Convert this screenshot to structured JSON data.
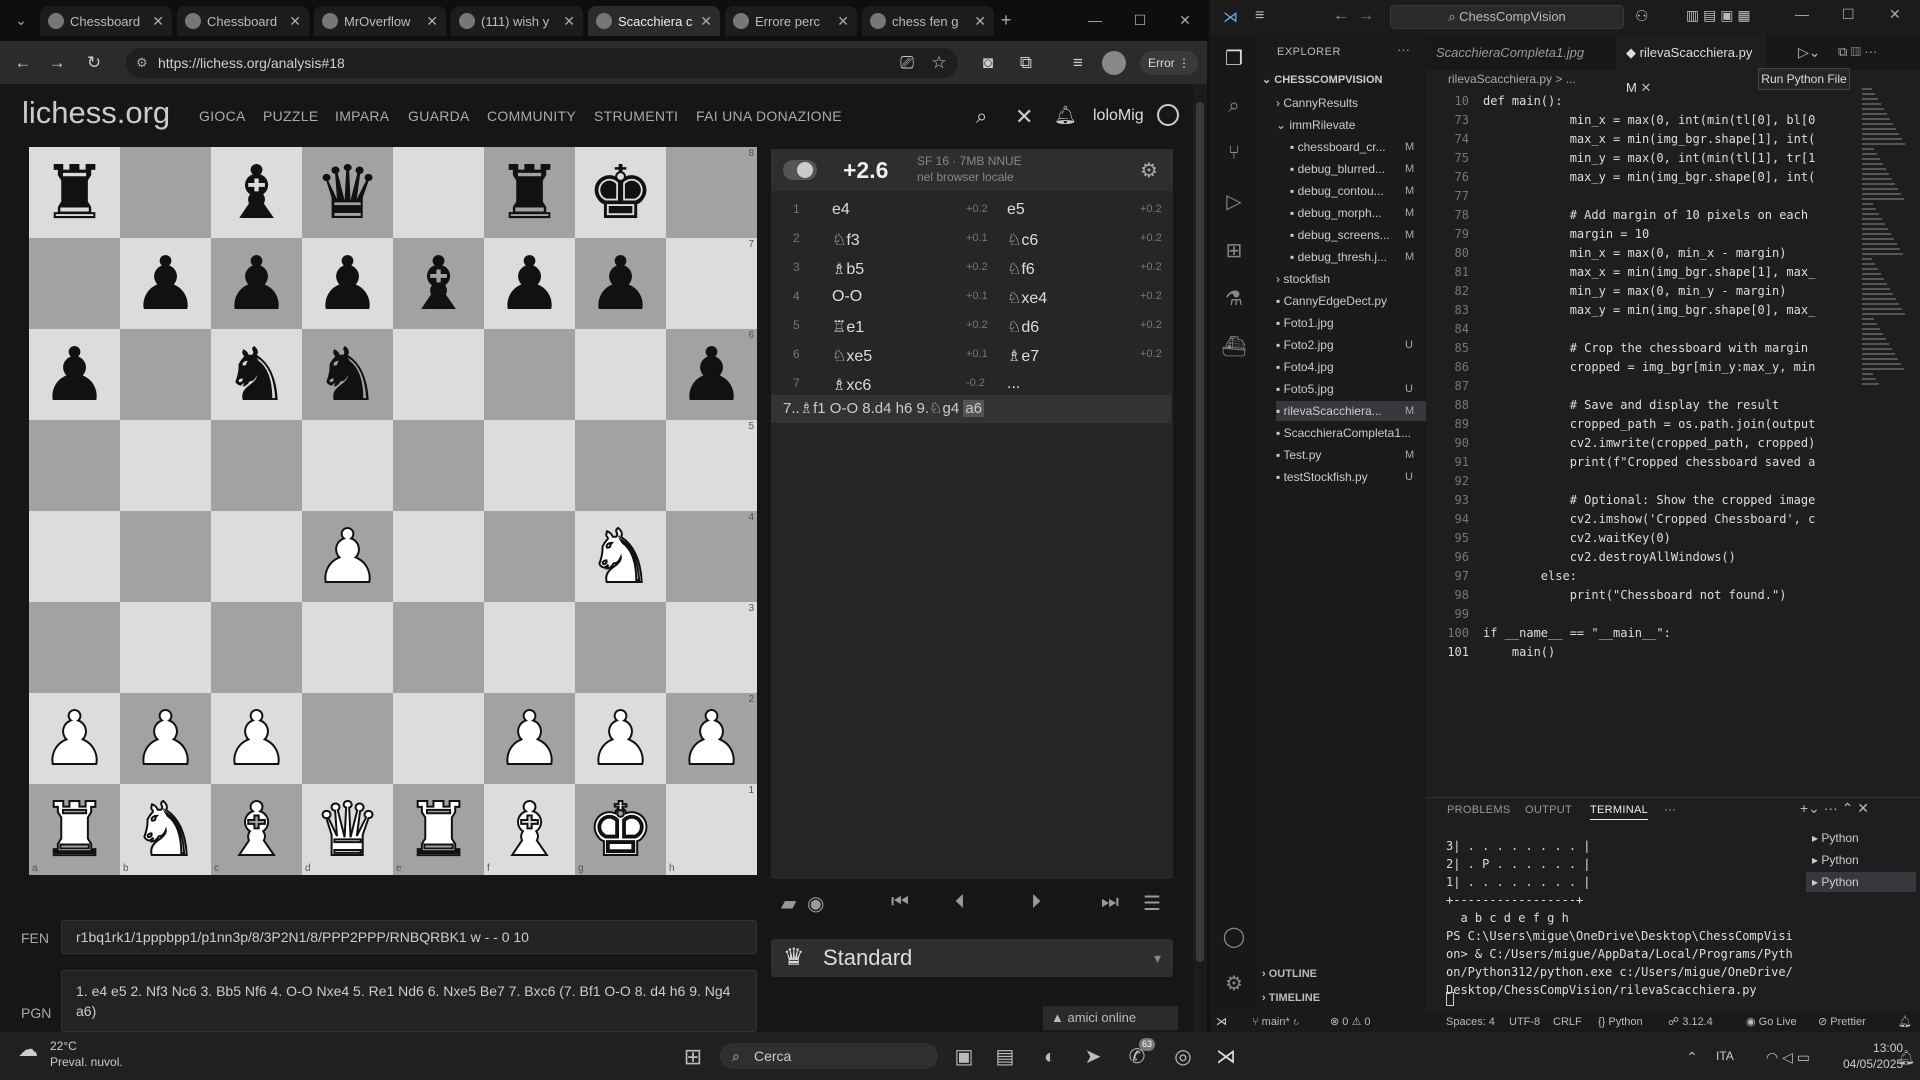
{
  "browser": {
    "tabs": [
      {
        "label": "Chessboard"
      },
      {
        "label": "Chessboard"
      },
      {
        "label": "MrOverflow"
      },
      {
        "label": "(111) wish y"
      },
      {
        "label": "Scacchiera c"
      },
      {
        "label": "Errore perc"
      },
      {
        "label": "chess fen g"
      }
    ],
    "url": "https://lichess.org/analysis#18",
    "profile_label": "Error"
  },
  "lichess": {
    "logo": "lichess.org",
    "nav": [
      "GIOCA",
      "PUZZLE",
      "IMPARA",
      "GUARDA",
      "COMMUNITY",
      "STRUMENTI",
      "FAI UNA DONAZIONE"
    ],
    "username": "loloMig",
    "board": {
      "ranks": [
        "8",
        "7",
        "6",
        "5",
        "4",
        "3",
        "2",
        "1"
      ],
      "files": [
        "a",
        "b",
        "c",
        "d",
        "e",
        "f",
        "g",
        "h"
      ],
      "rows": [
        [
          "bR",
          "",
          "bB",
          "bQ",
          "",
          "bR",
          "bK",
          ""
        ],
        [
          "",
          "bP",
          "bP",
          "bP",
          "bB",
          "bP",
          "bP",
          ""
        ],
        [
          "bP",
          "",
          "bN",
          "bN",
          "",
          "",
          "",
          "bP"
        ],
        [
          "",
          "",
          "",
          "",
          "",
          "",
          "",
          ""
        ],
        [
          "",
          "",
          "",
          "wP",
          "",
          "",
          "wN",
          ""
        ],
        [
          "",
          "",
          "",
          "",
          "",
          "",
          "",
          ""
        ],
        [
          "wP",
          "wP",
          "wP",
          "",
          "",
          "wP",
          "wP",
          "wP"
        ],
        [
          "wR",
          "wN",
          "wB",
          "wQ",
          "wR",
          "wB",
          "wK",
          ""
        ]
      ]
    },
    "engine": {
      "eval": "+2.6",
      "name": "SF 16 · 7MB NNUE",
      "location": "nel browser locale"
    },
    "moves": [
      {
        "n": "1",
        "w": "e4",
        "we": "+0.2",
        "b": "e5",
        "be": "+0.2"
      },
      {
        "n": "2",
        "w": "♘f3",
        "we": "+0.1",
        "b": "♘c6",
        "be": "+0.2"
      },
      {
        "n": "3",
        "w": "♗b5",
        "we": "+0.2",
        "b": "♘f6",
        "be": "+0.2"
      },
      {
        "n": "4",
        "w": "O-O",
        "we": "+0.1",
        "b": "♘xe4",
        "be": "+0.2"
      },
      {
        "n": "5",
        "w": "♖e1",
        "we": "+0.2",
        "b": "♘d6",
        "be": "+0.2"
      },
      {
        "n": "6",
        "w": "♘xe5",
        "we": "+0.1",
        "b": "♗e7",
        "be": "+0.2"
      },
      {
        "n": "7",
        "w": "♗xc6",
        "we": "-0.2",
        "b": "...",
        "be": ""
      }
    ],
    "pv_line": "7..♗f1 O-O 8.d4 h6 9.♘g4",
    "pv_last": "a6",
    "variant": "Standard",
    "fen_label": "FEN",
    "fen": "r1bq1rk1/1pppbpp1/p1nn3p/8/3P2N1/8/PPP2PPP/RNBQRBK1 w - - 0 10",
    "pgn_label": "PGN",
    "pgn": "1. e4 e5 2. Nf3 Nc6 3. Bb5 Nf6 4. O-O Nxe4 5. Re1 Nd6 6. Nxe5 Be7 7. Bxc6 (7. Bf1 O-O 8. d4 h6 9. Ng4 a6)",
    "friends": "amici online"
  },
  "vscode": {
    "search": "ChessCompVision",
    "explorer_title": "EXPLORER",
    "project": "CHESSCOMPVISION",
    "tree": [
      {
        "label": "CannyResults",
        "status": "",
        "indent": 1
      },
      {
        "label": "immRilevate",
        "status": "",
        "indent": 1
      },
      {
        "label": "chessboard_cr...",
        "status": "M",
        "indent": 2
      },
      {
        "label": "debug_blurred...",
        "status": "M",
        "indent": 2
      },
      {
        "label": "debug_contou...",
        "status": "M",
        "indent": 2
      },
      {
        "label": "debug_morph...",
        "status": "M",
        "indent": 2
      },
      {
        "label": "debug_screens...",
        "status": "M",
        "indent": 2
      },
      {
        "label": "debug_thresh.j...",
        "status": "M",
        "indent": 2
      },
      {
        "label": "stockfish",
        "status": "",
        "indent": 1
      },
      {
        "label": "CannyEdgeDect.py",
        "status": "",
        "indent": 1
      },
      {
        "label": "Foto1.jpg",
        "status": "",
        "indent": 1
      },
      {
        "label": "Foto2.jpg",
        "status": "U",
        "indent": 1
      },
      {
        "label": "Foto4.jpg",
        "status": "",
        "indent": 1
      },
      {
        "label": "Foto5.jpg",
        "status": "U",
        "indent": 1
      },
      {
        "label": "rilevaScacchiera...",
        "status": "M",
        "indent": 1
      },
      {
        "label": "ScacchieraCompleta1...",
        "status": "",
        "indent": 1
      },
      {
        "label": "Test.py",
        "status": "M",
        "indent": 1
      },
      {
        "label": "testStockfish.py",
        "status": "U",
        "indent": 1
      }
    ],
    "tabs": [
      {
        "label": "ScacchieraCompleta1.jpg"
      },
      {
        "label": "rilevaScacchiera.py M"
      }
    ],
    "breadcrumb": "rilevaScacchiera.py > ...",
    "tooltip": "Run Python File",
    "code": [
      {
        "n": "10",
        "t": "def main():"
      },
      {
        "n": "73",
        "t": "            min_x = max(0, int(min(tl[0], bl[0"
      },
      {
        "n": "74",
        "t": "            max_x = min(img_bgr.shape[1], int("
      },
      {
        "n": "75",
        "t": "            min_y = max(0, int(min(tl[1], tr[1"
      },
      {
        "n": "76",
        "t": "            max_y = min(img_bgr.shape[0], int("
      },
      {
        "n": "77",
        "t": ""
      },
      {
        "n": "78",
        "t": "            # Add margin of 10 pixels on each"
      },
      {
        "n": "79",
        "t": "            margin = 10"
      },
      {
        "n": "80",
        "t": "            min_x = max(0, min_x - margin)"
      },
      {
        "n": "81",
        "t": "            max_x = min(img_bgr.shape[1], max_"
      },
      {
        "n": "82",
        "t": "            min_y = max(0, min_y - margin)"
      },
      {
        "n": "83",
        "t": "            max_y = min(img_bgr.shape[0], max_"
      },
      {
        "n": "84",
        "t": ""
      },
      {
        "n": "85",
        "t": "            # Crop the chessboard with margin"
      },
      {
        "n": "86",
        "t": "            cropped = img_bgr[min_y:max_y, min"
      },
      {
        "n": "87",
        "t": ""
      },
      {
        "n": "88",
        "t": "            # Save and display the result"
      },
      {
        "n": "89",
        "t": "            cropped_path = os.path.join(output"
      },
      {
        "n": "90",
        "t": "            cv2.imwrite(cropped_path, cropped)"
      },
      {
        "n": "91",
        "t": "            print(f\"Cropped chessboard saved a"
      },
      {
        "n": "92",
        "t": ""
      },
      {
        "n": "93",
        "t": "            # Optional: Show the cropped image"
      },
      {
        "n": "94",
        "t": "            cv2.imshow('Cropped Chessboard', c"
      },
      {
        "n": "95",
        "t": "            cv2.waitKey(0)"
      },
      {
        "n": "96",
        "t": "            cv2.destroyAllWindows()"
      },
      {
        "n": "97",
        "t": "        else:"
      },
      {
        "n": "98",
        "t": "            print(\"Chessboard not found.\")"
      },
      {
        "n": "99",
        "t": ""
      },
      {
        "n": "100",
        "t": "if __name__ == \"__main__\":"
      },
      {
        "n": "101",
        "t": "    main()"
      }
    ],
    "panel_tabs": [
      "PROBLEMS",
      "OUTPUT",
      "TERMINAL"
    ],
    "terminal": [
      "3| . . . . . . . . |",
      "2| . P . . . . . . |",
      "1| . . . . . . . . |",
      "+-----------------+",
      "  a b c d e f g h",
      "PS C:\\Users\\migue\\OneDrive\\Desktop\\ChessCompVisi",
      "on> & C:/Users/migue/AppData/Local/Programs/Pyth",
      "on/Python312/python.exe c:/Users/migue/OneDrive/",
      "Desktop/ChessCompVision/rilevaScacchiera.py"
    ],
    "shells": [
      "Python",
      "Python",
      "Python"
    ],
    "outline": "OUTLINE",
    "timeline": "TIMELINE",
    "status": {
      "branch": "main*",
      "problems": "⊗ 0 ⚠ 0",
      "spaces": "Spaces: 4",
      "encoding": "UTF-8",
      "eol": "CRLF",
      "language": "{} Python",
      "version": "3.12.4",
      "golive": "Go Live",
      "prettier": "Prettier"
    }
  },
  "taskbar": {
    "temp": "22°C",
    "weather": "Preval. nuvol.",
    "search": "Cerca",
    "lang": "ITA",
    "time": "13:00",
    "date": "04/05/2025",
    "badge": "63"
  }
}
